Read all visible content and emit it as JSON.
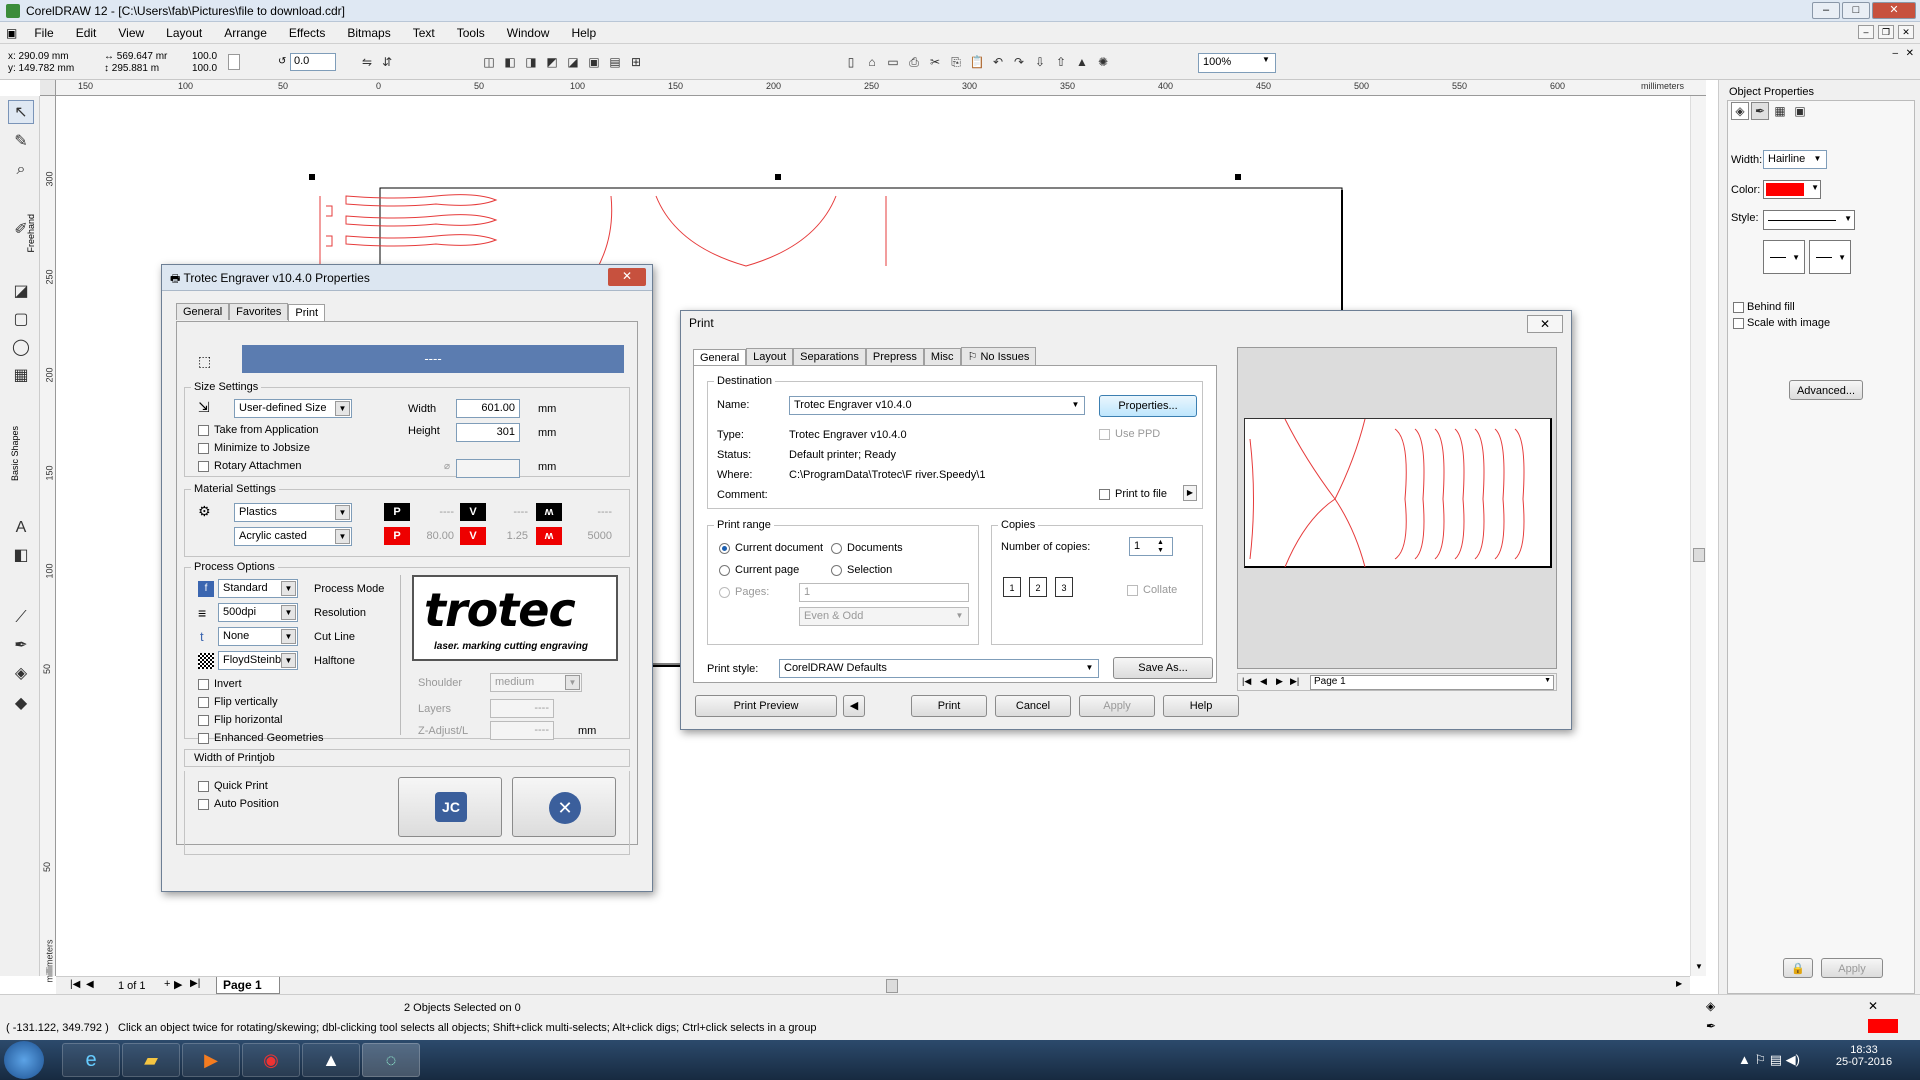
{
  "app": {
    "title": "CorelDRAW 12 - [C:\\Users\\fab\\Pictures\\file to download.cdr]",
    "menu": [
      "File",
      "Edit",
      "View",
      "Layout",
      "Arrange",
      "Effects",
      "Bitmaps",
      "Text",
      "Tools",
      "Window",
      "Help"
    ],
    "window_buttons": [
      "–",
      "□",
      "✕"
    ]
  },
  "propbar": {
    "x": "x: 290.09 mm",
    "y": "y: 149.782 mm",
    "w": "569.647 mr",
    "h": "295.881 m",
    "scale_x": "100.0",
    "scale_y": "100.0",
    "angle": "0.0",
    "zoom": "100%"
  },
  "ruler": {
    "h_ticks": [
      "150",
      "100",
      "50",
      "0",
      "50",
      "100",
      "150",
      "200",
      "250",
      "300",
      "350",
      "400",
      "450",
      "500",
      "550",
      "600"
    ],
    "unit": "millimeters",
    "v_ticks": [
      "300",
      "250",
      "200",
      "150",
      "100",
      "50",
      "50"
    ]
  },
  "toolbox": {
    "labels": [
      "Freehand",
      "Basic Shapes"
    ]
  },
  "docker": {
    "title": "Object Properties",
    "width_label": "Width:",
    "width_value": "Hairline",
    "color_label": "Color:",
    "color_value": "#ff0000",
    "style_label": "Style:",
    "behind_fill": "Behind fill",
    "scale_with_image": "Scale with image",
    "advanced": "Advanced...",
    "apply": "Apply"
  },
  "pages": {
    "counter": "1 of 1",
    "tab": "Page 1"
  },
  "status": {
    "selection": "2 Objects Selected on 0",
    "coords": "( -131.122, 349.792 )",
    "hint": "Click an object twice for rotating/skewing; dbl-clicking tool selects all objects; Shift+click multi-selects; Alt+click digs; Ctrl+click selects in a group"
  },
  "taskbar": {
    "time": "18:33",
    "date": "25-07-2016"
  },
  "trotec": {
    "title": "Trotec Engraver v10.4.0 Properties",
    "tabs": [
      "General",
      "Favorites",
      "Print"
    ],
    "banner": "----",
    "size_settings": "Size Settings",
    "size_combo": "User-defined Size",
    "width_label": "Width",
    "width_value": "601.00",
    "height_label": "Height",
    "height_value": "301",
    "unit": "mm",
    "take_from_app": "Take from Application",
    "minimize": "Minimize to Jobsize",
    "rotary": "Rotary Attachmen",
    "rotary_unit": "mm",
    "material_settings": "Material Settings",
    "material1": "Plastics",
    "material2": "Acrylic casted",
    "p_top": "----",
    "v_top": "----",
    "f_top": "----",
    "p_val": "80.00",
    "v_val": "1.25",
    "f_val": "5000",
    "process_options": "Process Options",
    "process_mode": "Standard",
    "process_mode_label": "Process Mode",
    "resolution": "500dpi",
    "resolution_label": "Resolution",
    "cut_line": "None",
    "cut_line_label": "Cut Line",
    "halftone": "FloydSteinbe",
    "halftone_label": "Halftone",
    "invert": "Invert",
    "flip_v": "Flip vertically",
    "flip_h": "Flip horizontal",
    "enhanced": "Enhanced Geometries",
    "logo": "trotec",
    "logo_tagline": "laser. marking cutting engraving",
    "shoulder": "Shoulder",
    "shoulder_value": "medium",
    "layers": "Layers",
    "layers_value": "----",
    "zadjust": "Z-Adjust/L",
    "zadjust_value": "----",
    "zunit": "mm",
    "width_of_printjob": "Width of Printjob",
    "quick_print": "Quick Print",
    "auto_position": "Auto Position"
  },
  "print": {
    "title": "Print",
    "tabs": [
      "General",
      "Layout",
      "Separations",
      "Prepress",
      "Misc",
      "No Issues"
    ],
    "destination": "Destination",
    "name_label": "Name:",
    "name_value": "Trotec Engraver v10.4.0",
    "properties": "Properties...",
    "type_label": "Type:",
    "type_value": "Trotec Engraver v10.4.0",
    "status_label": "Status:",
    "status_value": "Default printer; Ready",
    "where_label": "Where:",
    "where_value": "C:\\ProgramData\\Trotec\\F          river.Speedy\\1",
    "comment_label": "Comment:",
    "use_ppd": "Use PPD",
    "print_to_file": "Print to file",
    "print_range": "Print range",
    "current_document": "Current document",
    "documents": "Documents",
    "current_page": "Current page",
    "selection": "Selection",
    "pages": "Pages:",
    "pages_value": "1",
    "even_odd": "Even & Odd",
    "copies": "Copies",
    "num_copies": "Number of copies:",
    "num_copies_value": "1",
    "collate": "Collate",
    "print_style_label": "Print style:",
    "print_style_value": "CorelDRAW Defaults",
    "save_as": "Save As...",
    "print_preview": "Print Preview",
    "print_btn": "Print",
    "cancel": "Cancel",
    "apply": "Apply",
    "help": "Help",
    "preview_page": "Page 1"
  }
}
